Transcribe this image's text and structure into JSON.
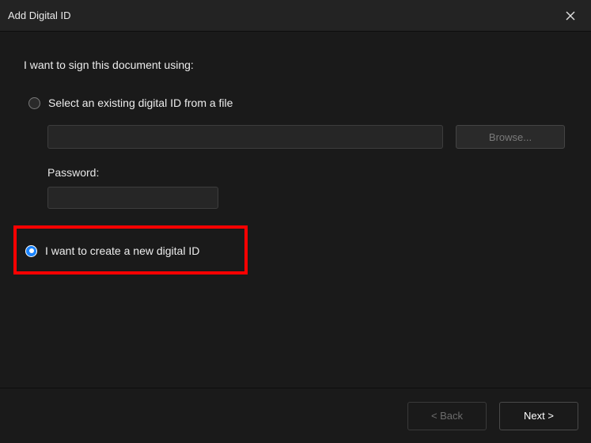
{
  "dialog": {
    "title": "Add Digital ID"
  },
  "main": {
    "heading": "I want to sign this document using:",
    "option_existing": {
      "label": "Select an existing digital ID from a file",
      "selected": false
    },
    "file_path_value": "",
    "browse_label": "Browse...",
    "password_label": "Password:",
    "password_value": "",
    "option_create": {
      "label": "I want to create a new digital ID",
      "selected": true
    }
  },
  "footer": {
    "back_label": "<  Back",
    "next_label": "Next  >"
  },
  "highlight": {
    "target": "option_create"
  }
}
